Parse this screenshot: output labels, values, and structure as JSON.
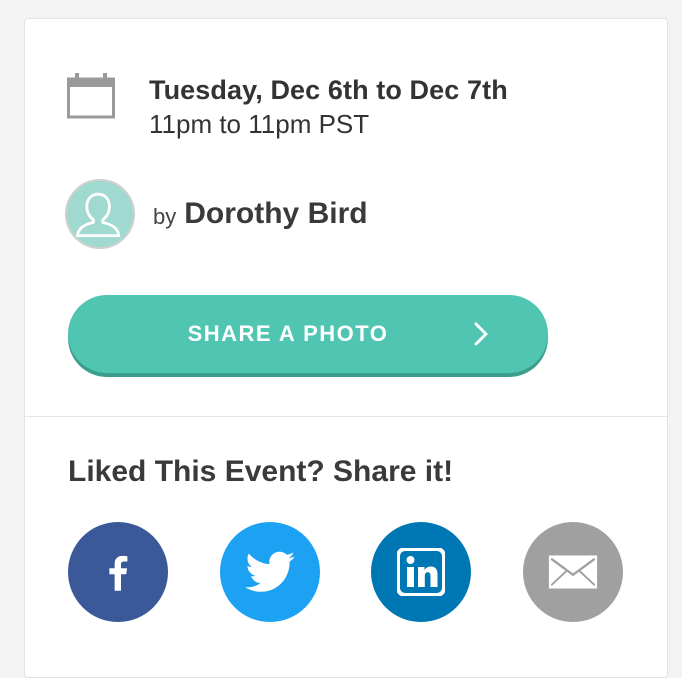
{
  "event": {
    "date_line": "Tuesday, Dec 6th to Dec 7th",
    "time_line": "11pm to 11pm PST",
    "calendar_icon": "calendar-icon"
  },
  "host": {
    "by_label": "by",
    "name": "Dorothy Bird",
    "avatar_icon": "person-silhouette-icon"
  },
  "share_photo": {
    "label": "SHARE A PHOTO",
    "icon": "chevron-right-icon",
    "color": "#50c6b2"
  },
  "share": {
    "heading": "Liked This Event? Share it!",
    "networks": [
      {
        "name": "facebook",
        "icon": "facebook-icon",
        "color": "#3b5998"
      },
      {
        "name": "twitter",
        "icon": "twitter-icon",
        "color": "#1da1f2"
      },
      {
        "name": "linkedin",
        "icon": "linkedin-icon",
        "color": "#0077b5"
      },
      {
        "name": "email",
        "icon": "envelope-icon",
        "color": "#a0a0a0"
      }
    ]
  }
}
